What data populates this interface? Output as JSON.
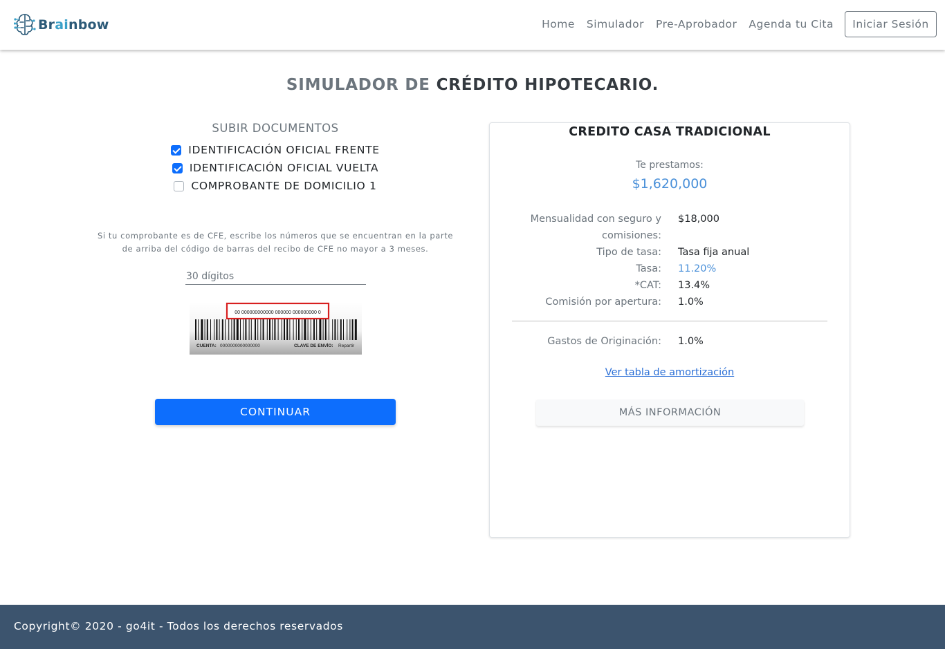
{
  "header": {
    "brand": {
      "pre": "Br",
      "mid": "ai",
      "post": "nbow"
    },
    "nav": [
      "Home",
      "Simulador",
      "Pre-Aprobador",
      "Agenda tu Cita"
    ],
    "login_label": "Iniciar Sesión"
  },
  "page": {
    "title_part1": "SIMULADOR DE ",
    "title_part2": "CRÉDITO HIPOTECARIO."
  },
  "documents": {
    "title": "SUBIR DOCUMENTOS",
    "items": [
      {
        "label": "IDENTIFICACIÓN OFICIAL FRENTE",
        "checked": true
      },
      {
        "label": "IDENTIFICACIÓN OFICIAL VUELTA",
        "checked": true
      },
      {
        "label": "COMPROBANTE DE DOMICILIO 1",
        "checked": false
      }
    ],
    "cfe_note_line1": "Si tu comprobante es de CFE, escribe los números que se encuentran en la parte",
    "cfe_note_line2": "de arriba del código de barras del recibo de CFE no mayor a 3 meses.",
    "digits_placeholder": "30 dígitos",
    "digits_value": "",
    "barcode": {
      "top_number": "00 000000000000 000000 000000000 0",
      "cuenta_label": "CUENTA:",
      "cuenta_value": "0000000000000000",
      "clave_label": "CLAVE DE ENVÍO:",
      "clave_value": "Repartir"
    },
    "continue_label": "CONTINUAR"
  },
  "credit": {
    "title": "CREDITO CASA TRADICIONAL",
    "lend_label": "Te prestamos:",
    "lend_amount": "$1,620,000",
    "rows": [
      {
        "label_line1": "Mensualidad con seguro y",
        "label_line2": "comisiones:",
        "value": "$18,000"
      },
      {
        "label": "Tipo de tasa:",
        "value": "Tasa fija anual"
      },
      {
        "label": "Tasa:",
        "value": "11.20%"
      },
      {
        "label": "*CAT:",
        "value": "13.4%"
      },
      {
        "label": "Comisión por apertura:",
        "value": "1.0%"
      },
      {
        "label": "Gastos de Originación:",
        "value": "1.0%"
      }
    ],
    "amortization_link": "Ver tabla de amortización",
    "more_info_label": "MÁS INFORMACIÓN"
  },
  "footer": {
    "copyright": "Copyright© 2020 - go4it - Todos los derechos reservados"
  },
  "colors": {
    "primary": "#0d6efd",
    "accent_blue": "#4a90d9",
    "footer_bg": "#3c546e",
    "brand_dark": "#2c5a78",
    "brand_light": "#3aa0c8"
  }
}
